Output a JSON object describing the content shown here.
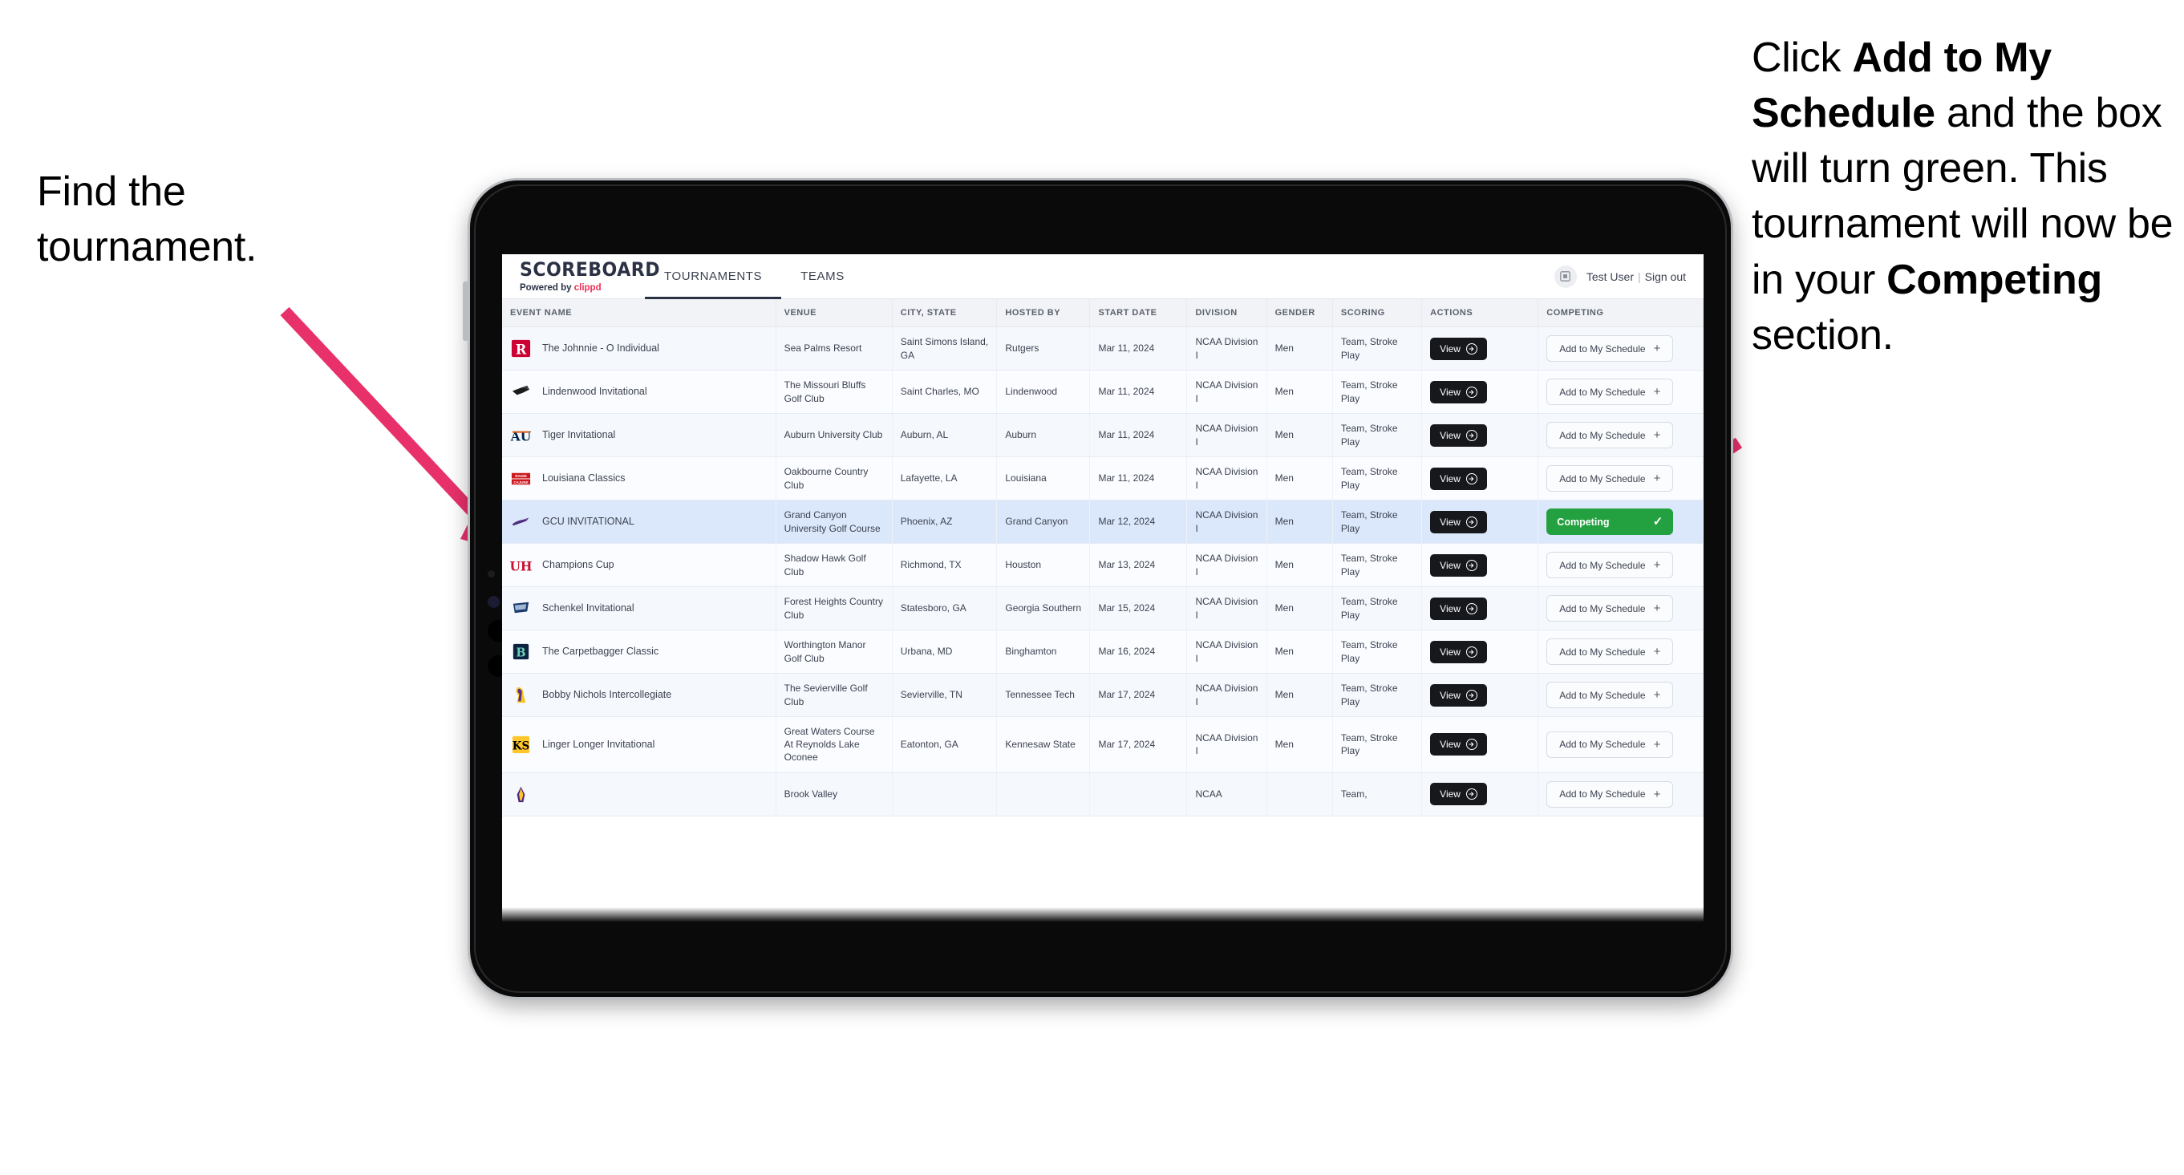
{
  "annotations": {
    "left": {
      "line1": "Find the",
      "line2": "tournament."
    },
    "right": {
      "part1": "Click ",
      "bold1": "Add to My Schedule",
      "part2": " and the box will turn green. This tournament will now be in your ",
      "bold2": "Competing",
      "part3": " section."
    },
    "arrow_color": "#e8316a"
  },
  "app": {
    "brand": {
      "title": "SCOREBOARD",
      "powered_prefix": "Powered by ",
      "powered_name": "clippd"
    },
    "tabs": [
      {
        "label": "TOURNAMENTS",
        "active": true
      },
      {
        "label": "TEAMS",
        "active": false
      }
    ],
    "user": {
      "name": "Test User",
      "separator": "|",
      "sign_out": "Sign out"
    },
    "columns": [
      "EVENT NAME",
      "VENUE",
      "CITY, STATE",
      "HOSTED BY",
      "START DATE",
      "DIVISION",
      "GENDER",
      "SCORING",
      "ACTIONS",
      "COMPETING"
    ],
    "buttons": {
      "view": "View",
      "add": "Add to My Schedule",
      "add_plus": "+",
      "competing": "Competing",
      "competing_check": "✓"
    },
    "rows": [
      {
        "event": "The Johnnie - O Individual",
        "venue": "Sea Palms Resort",
        "city": "Saint Simons Island, GA",
        "host": "Rutgers",
        "date": "Mar 11, 2024",
        "division": "NCAA Division I",
        "gender": "Men",
        "scoring": "Team, Stroke Play",
        "competing": false
      },
      {
        "event": "Lindenwood Invitational",
        "venue": "The Missouri Bluffs Golf Club",
        "city": "Saint Charles, MO",
        "host": "Lindenwood",
        "date": "Mar 11, 2024",
        "division": "NCAA Division I",
        "gender": "Men",
        "scoring": "Team, Stroke Play",
        "competing": false
      },
      {
        "event": "Tiger Invitational",
        "venue": "Auburn University Club",
        "city": "Auburn, AL",
        "host": "Auburn",
        "date": "Mar 11, 2024",
        "division": "NCAA Division I",
        "gender": "Men",
        "scoring": "Team, Stroke Play",
        "competing": false
      },
      {
        "event": "Louisiana Classics",
        "venue": "Oakbourne Country Club",
        "city": "Lafayette, LA",
        "host": "Louisiana",
        "date": "Mar 11, 2024",
        "division": "NCAA Division I",
        "gender": "Men",
        "scoring": "Team, Stroke Play",
        "competing": false
      },
      {
        "event": "GCU INVITATIONAL",
        "venue": "Grand Canyon University Golf Course",
        "city": "Phoenix, AZ",
        "host": "Grand Canyon",
        "date": "Mar 12, 2024",
        "division": "NCAA Division I",
        "gender": "Men",
        "scoring": "Team, Stroke Play",
        "competing": true
      },
      {
        "event": "Champions Cup",
        "venue": "Shadow Hawk Golf Club",
        "city": "Richmond, TX",
        "host": "Houston",
        "date": "Mar 13, 2024",
        "division": "NCAA Division I",
        "gender": "Men",
        "scoring": "Team, Stroke Play",
        "competing": false
      },
      {
        "event": "Schenkel Invitational",
        "venue": "Forest Heights Country Club",
        "city": "Statesboro, GA",
        "host": "Georgia Southern",
        "date": "Mar 15, 2024",
        "division": "NCAA Division I",
        "gender": "Men",
        "scoring": "Team, Stroke Play",
        "competing": false
      },
      {
        "event": "The Carpetbagger Classic",
        "venue": "Worthington Manor Golf Club",
        "city": "Urbana, MD",
        "host": "Binghamton",
        "date": "Mar 16, 2024",
        "division": "NCAA Division I",
        "gender": "Men",
        "scoring": "Team, Stroke Play",
        "competing": false
      },
      {
        "event": "Bobby Nichols Intercollegiate",
        "venue": "The Sevierville Golf Club",
        "city": "Sevierville, TN",
        "host": "Tennessee Tech",
        "date": "Mar 17, 2024",
        "division": "NCAA Division I",
        "gender": "Men",
        "scoring": "Team, Stroke Play",
        "competing": false
      },
      {
        "event": "Linger Longer Invitational",
        "venue": "Great Waters Course At Reynolds Lake Oconee",
        "city": "Eatonton, GA",
        "host": "Kennesaw State",
        "date": "Mar 17, 2024",
        "division": "NCAA Division I",
        "gender": "Men",
        "scoring": "Team, Stroke Play",
        "competing": false
      },
      {
        "event": "",
        "venue": "Brook Valley",
        "city": "",
        "host": "",
        "date": "",
        "division": "NCAA",
        "gender": "",
        "scoring": "Team,",
        "competing": false
      }
    ]
  }
}
